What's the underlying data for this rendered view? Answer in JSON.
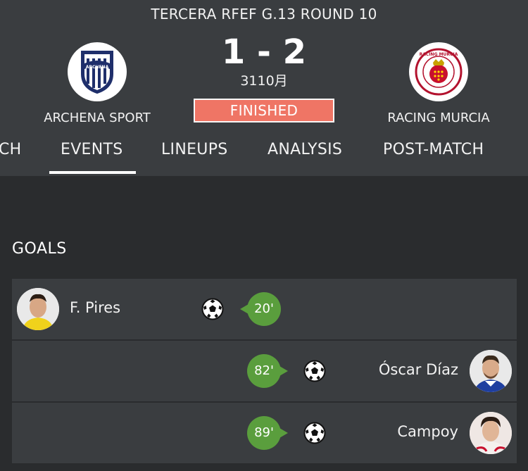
{
  "competition": {
    "title": "TERCERA RFEF G.13 ROUND 10"
  },
  "match": {
    "home_team": "ARCHENA SPORT",
    "away_team": "RACING MURCIA",
    "score": "1 - 2",
    "score_sub": "3110月",
    "status": "FINISHED",
    "home_crest_text": "ARCHENA",
    "away_crest_text": "RACING MURCIA"
  },
  "tabs": [
    {
      "label": "CH"
    },
    {
      "label": "EVENTS",
      "active": true
    },
    {
      "label": "LINEUPS"
    },
    {
      "label": "ANALYSIS"
    },
    {
      "label": "POST-MATCH"
    }
  ],
  "goals": {
    "title": "GOALS",
    "events": [
      {
        "player": "F. Pires",
        "minute": "20'",
        "side": "home"
      },
      {
        "player": "Óscar Díaz",
        "minute": "82'",
        "side": "away"
      },
      {
        "player": "Campoy",
        "minute": "89'",
        "side": "away"
      }
    ]
  },
  "colors": {
    "header_bg": "#3a3d40",
    "page_bg": "#2a2c2e",
    "status_bg": "#ef7565",
    "minute_bg": "#5a9e3d"
  },
  "icons": {
    "goal": "soccer-ball-icon"
  }
}
